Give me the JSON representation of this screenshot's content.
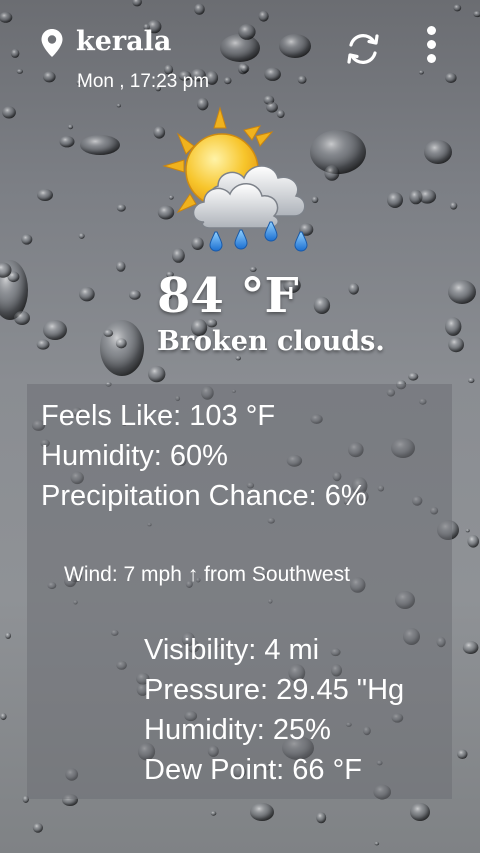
{
  "header": {
    "location": "kerala",
    "datetime": "Mon , 17:23 pm",
    "location_icon": "location-pin-icon",
    "refresh_icon": "refresh-icon",
    "menu_icon": "more-vert-icon"
  },
  "current": {
    "condition_icon": "sun-clouds-rain-icon",
    "temperature": "84 °F",
    "condition": "Broken clouds."
  },
  "details": {
    "feels_like": "Feels Like: 103 °F",
    "humidity": "Humidity: 60%",
    "precipitation": "Precipitation Chance: 6%",
    "wind": "Wind: 7 mph ↑ from Southwest",
    "visibility": "Visibility:  4 mi",
    "pressure": "Pressure:  29.45 \"Hg",
    "humidity2": "Humidity:  25%",
    "dew_point": "Dew Point:  66 °F"
  }
}
